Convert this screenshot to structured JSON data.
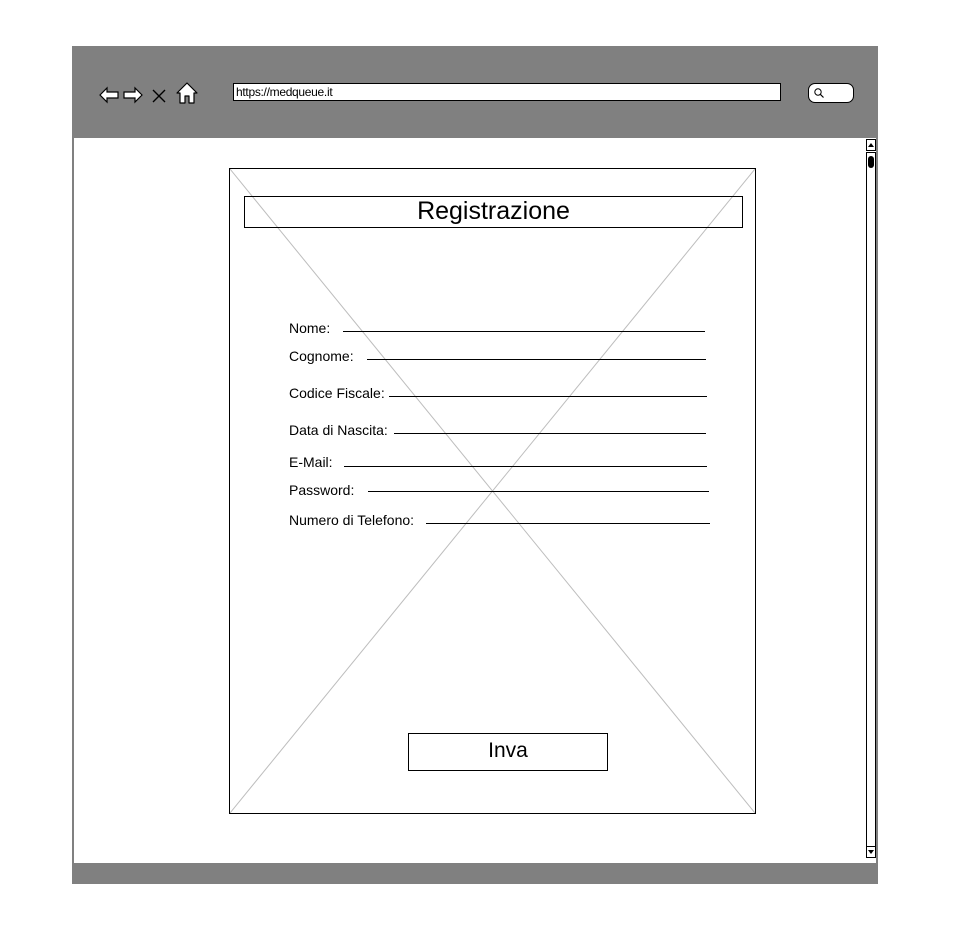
{
  "browser": {
    "url": "https://medqueue.it",
    "icons": [
      "back-arrow-icon",
      "forward-arrow-icon",
      "close-icon",
      "home-icon",
      "search-icon"
    ]
  },
  "form": {
    "title": "Registrazione",
    "fields": [
      {
        "label": "Nome:",
        "value": ""
      },
      {
        "label": "Cognome:",
        "value": ""
      },
      {
        "label": "Codice Fiscale:",
        "value": ""
      },
      {
        "label": "Data di Nascita:",
        "value": ""
      },
      {
        "label": "E-Mail:",
        "value": ""
      },
      {
        "label": "Password:",
        "value": ""
      },
      {
        "label": "Numero di Telefono:",
        "value": ""
      }
    ],
    "submit_label": "Inva"
  },
  "colors": {
    "chrome": "#808080",
    "page": "#ffffff",
    "ink": "#000000",
    "placeholder_cross": "#bdbdbd"
  }
}
